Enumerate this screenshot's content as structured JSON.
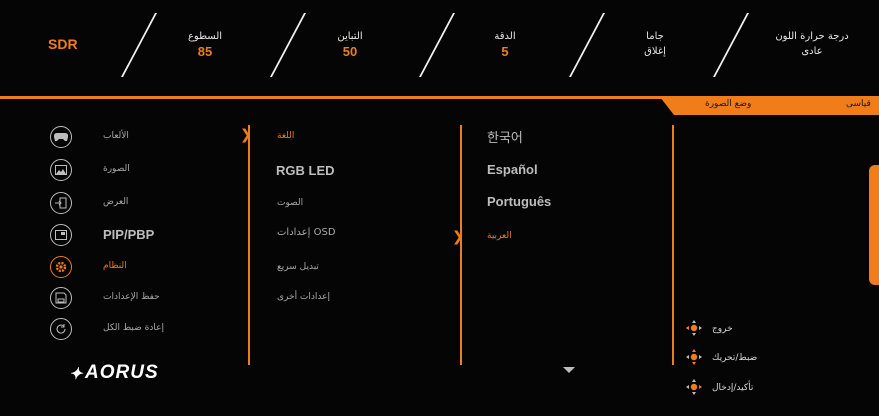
{
  "top_bar": {
    "mode": "SDR",
    "brightness": {
      "label": "السطوع",
      "value": "85"
    },
    "contrast": {
      "label": "التباين",
      "value": "50"
    },
    "sharpness": {
      "label": "الدقة",
      "value": "5"
    },
    "gamma": {
      "label": "جاما",
      "value": "إغلاق"
    },
    "color_temp": {
      "label": "درجة حرارة اللون",
      "value": "عادى"
    }
  },
  "tabs": {
    "picture_mode": "وضع الصورة",
    "standard": "قياسى"
  },
  "main_menu": [
    {
      "label": "الألعاب",
      "icon": "gamepad-icon"
    },
    {
      "label": "الصورة",
      "icon": "picture-icon"
    },
    {
      "label": "العرض",
      "icon": "display-input-icon"
    },
    {
      "label": "PIP/PBP",
      "icon": "pip-icon"
    },
    {
      "label": "النظام",
      "icon": "gear-icon"
    },
    {
      "label": "حفظ الإعدادات",
      "icon": "save-icon"
    },
    {
      "label": "إعادة ضبط الكل",
      "icon": "reset-icon"
    }
  ],
  "sub_menu": [
    "اللغة",
    "RGB LED",
    "الصوت",
    "إعدادات OSD",
    "تبديل سريع",
    "إعدادات أخرى"
  ],
  "languages": [
    "한국어",
    "Español",
    "Português",
    "العربية"
  ],
  "brand": "AORUS",
  "hints": [
    {
      "label": "خروج"
    },
    {
      "label": "ضبط/تحريك"
    },
    {
      "label": "تأكيد/إدخال"
    }
  ],
  "colors": {
    "accent": "#f07d19",
    "background": "#050505"
  }
}
